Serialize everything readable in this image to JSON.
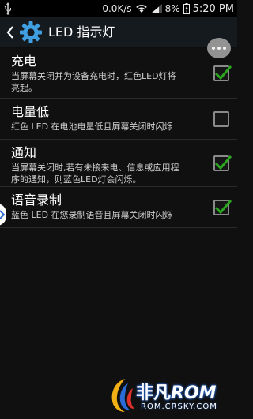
{
  "status_bar": {
    "speed": "0.0K/s",
    "battery": "8%",
    "time": "5:20 PM"
  },
  "action_bar": {
    "title": "LED 指示灯"
  },
  "settings": [
    {
      "title": "充电",
      "desc_lines": [
        "当屏幕关闭并为设备充电时，红色LED灯将",
        "亮起。"
      ],
      "checked": true
    },
    {
      "title": "电量低",
      "desc_lines": [
        "红色 LED 在电池电量低且屏幕关闭时闪烁"
      ],
      "checked": false
    },
    {
      "title": "通知",
      "desc_lines": [
        "当屏幕关闭时,若有未接来电、信息或应用程",
        "序的通知，则蓝色LED灯会闪烁。"
      ],
      "checked": true
    },
    {
      "title": "语音录制",
      "desc_lines": [
        "蓝色 LED 在您录制语音且屏幕关闭时闪烁"
      ],
      "checked": true
    }
  ],
  "watermark": {
    "main_cn": "非凡",
    "main_en": "ROM",
    "sub": "ROM.CRSKY.COM"
  },
  "colors": {
    "accent": "#3f9fe0",
    "check": "#2ba51f",
    "action_bar_bg": "#151a1f"
  }
}
